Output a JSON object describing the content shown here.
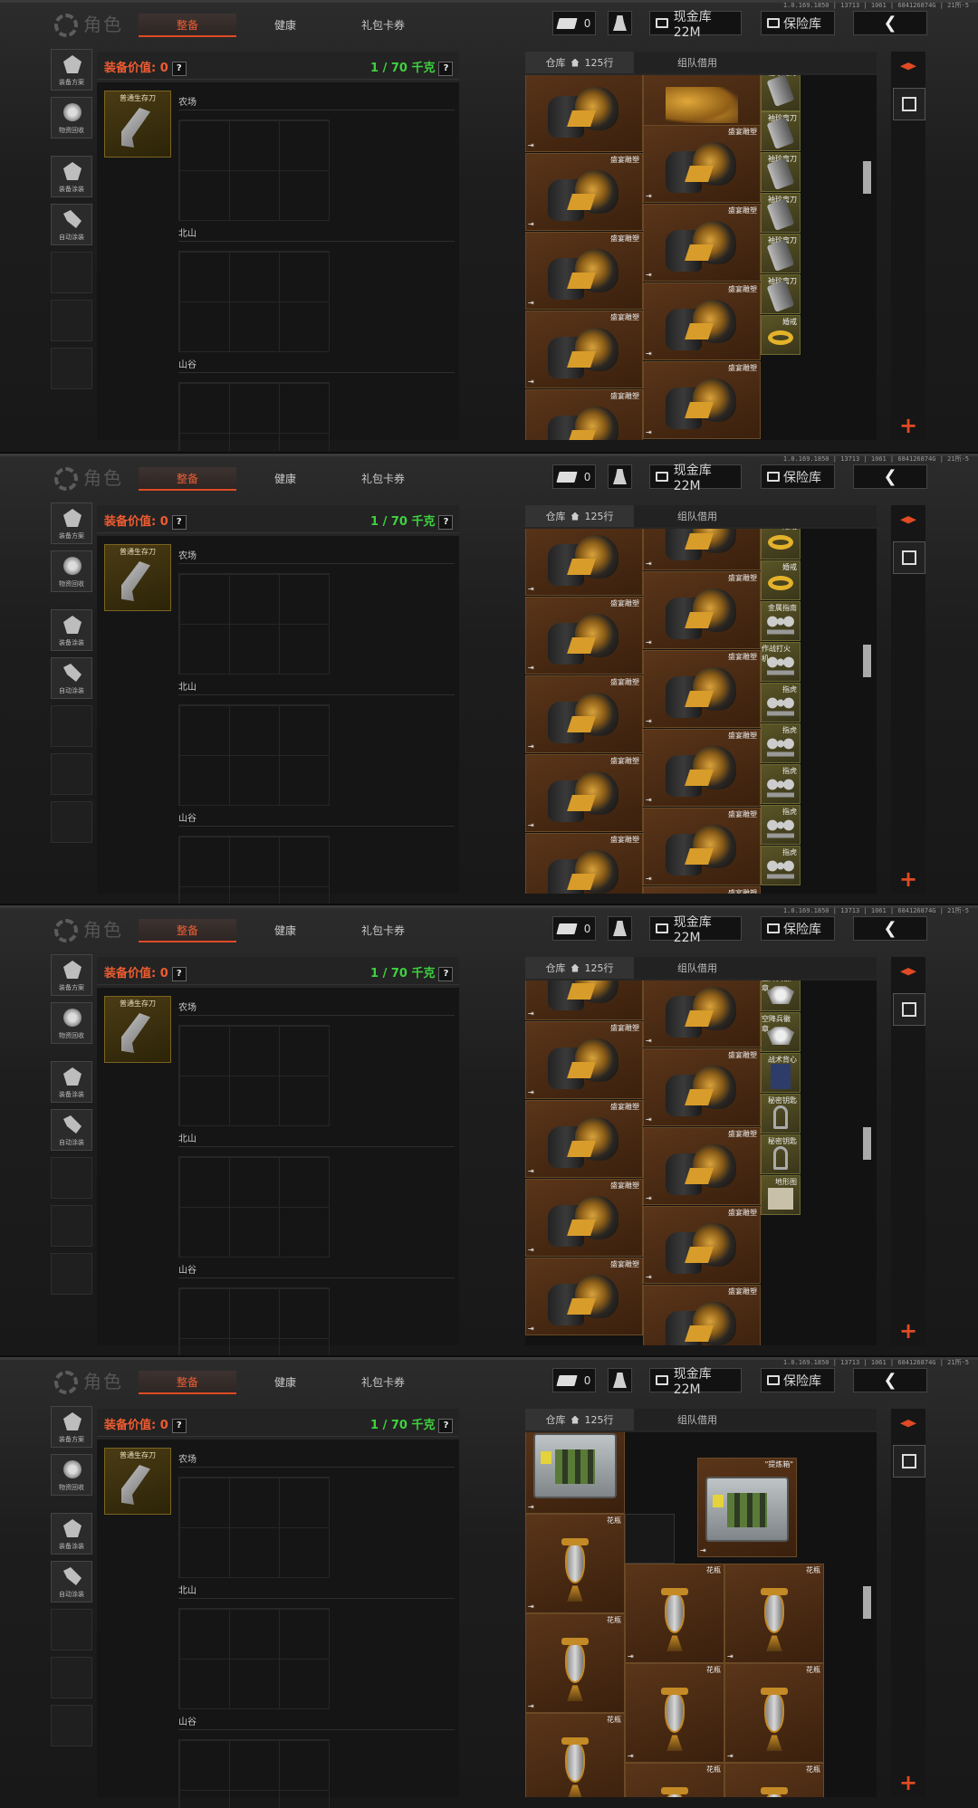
{
  "version": "1.0.169.1850 | 13713 | 1061 | 684126874G | 21所-5",
  "header": {
    "title": "角色",
    "tabs": [
      "整备",
      "健康",
      "礼包卡券"
    ],
    "ticket_count": "0",
    "cash": "现金库 22M",
    "safe": "保险库",
    "back": "❮"
  },
  "left_nav": [
    {
      "label": "装备方案",
      "icon": "helmet-icon"
    },
    {
      "label": "物资回收",
      "icon": "recycle-icon"
    },
    {
      "label": "装备涂装",
      "icon": "paint-icon"
    },
    {
      "label": "自动涂装",
      "icon": "auto-paint-icon"
    }
  ],
  "middle": {
    "equip_value_label": "装备价值: 0",
    "weight": "1 / 70 千克",
    "help": "?",
    "equipped_item": "普通生存刀",
    "sections": [
      "农场",
      "北山",
      "山谷"
    ]
  },
  "warehouse": {
    "tab_storage": "仓库",
    "capacity": "125行",
    "tab_team": "组队借用",
    "add": "+",
    "item_names": {
      "bust": "盛宴雕塑",
      "knife": "袖珍弯刀",
      "ring": "婚戒",
      "compass": "金属指南",
      "lighter": "作战打火机",
      "knuckle": "指虎",
      "badge": "空降兵徽章",
      "vest": "战术背心",
      "key": "秘密钥匙",
      "map": "地形图",
      "crate": "\"提炼箱\"",
      "vase": "花瓶"
    }
  },
  "colors": {
    "accent": "#ef5c31",
    "weight_green": "#3fd23f",
    "cell_brown": "#4a2a12",
    "cell_olive": "#4d4a22"
  }
}
